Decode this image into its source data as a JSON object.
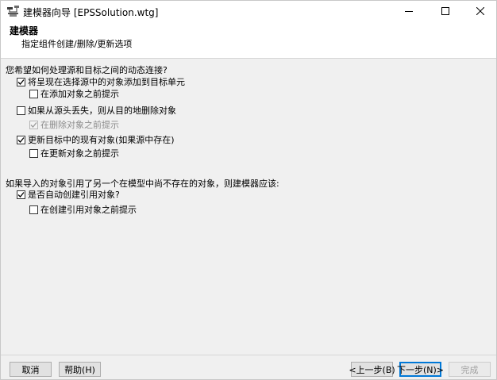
{
  "window": {
    "title": "建模器向导 [EPSSolution.wtg]"
  },
  "header": {
    "title": "建模器",
    "subtitle": "指定组件创建/删除/更新选项"
  },
  "section1": {
    "question": "您希望如何处理源和目标之间的动态连接?",
    "options": [
      {
        "label": "将呈现在选择源中的对象添加到目标单元",
        "checked": true,
        "enabled": true
      },
      {
        "label": "在添加对象之前提示",
        "checked": false,
        "enabled": true
      },
      {
        "label": "如果从源头丢失，则从目的地删除对象",
        "checked": false,
        "enabled": true
      },
      {
        "label": "在删除对象之前提示",
        "checked": true,
        "enabled": false
      },
      {
        "label": "更新目标中的现有对象(如果源中存在)",
        "checked": true,
        "enabled": true
      },
      {
        "label": "在更新对象之前提示",
        "checked": false,
        "enabled": true
      }
    ]
  },
  "section2": {
    "question": "如果导入的对象引用了另一个在模型中尚不存在的对象，则建模器应该:",
    "options": [
      {
        "label": "是否自动创建引用对象?",
        "checked": true,
        "enabled": true
      },
      {
        "label": "在创建引用对象之前提示",
        "checked": false,
        "enabled": true
      }
    ]
  },
  "buttons": {
    "cancel": "取消",
    "help": "帮助(H)",
    "back": "<上一步(B)",
    "next": "下一步(N)>",
    "finish": "完成"
  }
}
